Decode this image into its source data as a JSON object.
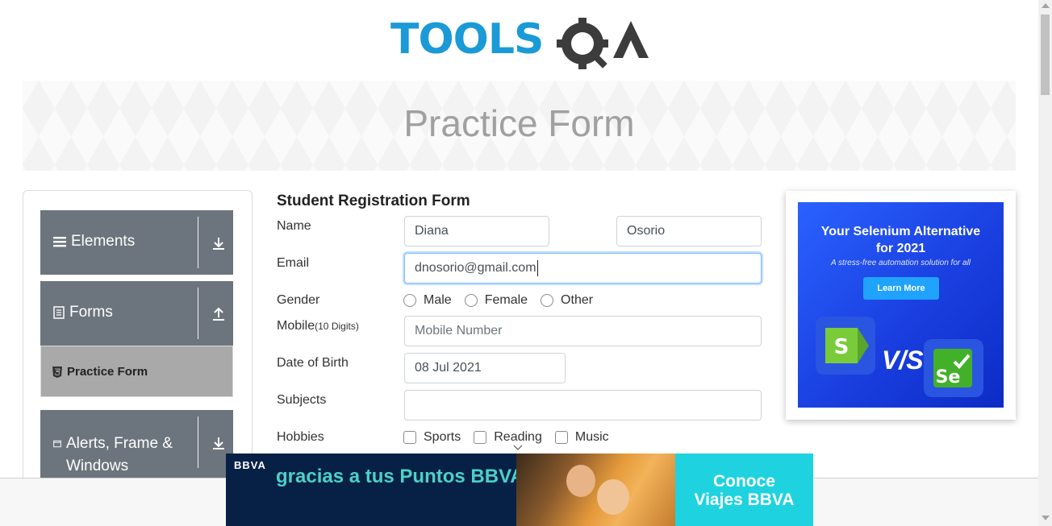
{
  "brand": {
    "logo_text": "TOOLSQA",
    "colors": {
      "primary": "#1a9ad6",
      "dark": "#3c3c3c"
    }
  },
  "banner": {
    "title": "Practice Form"
  },
  "sidebar": {
    "groups": [
      {
        "label": "Elements",
        "icon": "menu-icon",
        "arrow": "download-arrow-icon"
      },
      {
        "label": "Forms",
        "icon": "document-icon",
        "arrow": "upload-arrow-icon"
      },
      {
        "label": "Alerts, Frame & Windows",
        "icon": "window-icon",
        "arrow": "download-arrow-icon"
      }
    ],
    "active_item": {
      "label": "Practice Form",
      "icon": "html5-icon"
    }
  },
  "form": {
    "title": "Student Registration Form",
    "name_label": "Name",
    "first_name": "Diana",
    "last_name": "Osorio",
    "email_label": "Email",
    "email": "dnosorio@gmail.com",
    "gender_label": "Gender",
    "genders": [
      "Male",
      "Female",
      "Other"
    ],
    "mobile_label": "Mobile",
    "mobile_hint": "(10 Digits)",
    "mobile_placeholder": "Mobile Number",
    "dob_label": "Date of Birth",
    "dob": "08 Jul 2021",
    "subjects_label": "Subjects",
    "subjects_value": "",
    "hobbies_label": "Hobbies",
    "hobbies": [
      "Sports",
      "Reading",
      "Music"
    ]
  },
  "ad_right": {
    "headline": "Your Selenium Alternative for 2021",
    "subline": "A stress-free automation solution for all",
    "button": "Learn More",
    "vs_text": "V/S",
    "logo_left": "S",
    "logo_right": "Se",
    "colors": {
      "bg": "#1a3fe0",
      "button": "#1fa3ff"
    }
  },
  "ad_bottom": {
    "logo": "BBVA",
    "slogan": "gracias a tus Puntos BBVA",
    "cta_line1": "Conoce",
    "cta_line2": "Viajes BBVA",
    "colors": {
      "bg": "#072146",
      "accent": "#1ed3df"
    }
  }
}
